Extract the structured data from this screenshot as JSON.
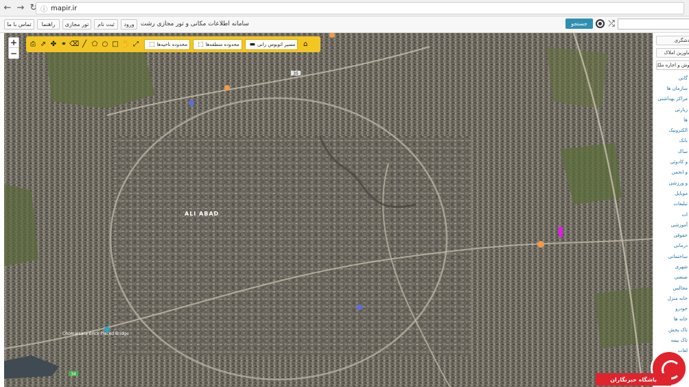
{
  "browser": {
    "url": "mapir.ir",
    "back_icon": "←",
    "forward_icon": "→",
    "reload_icon": "↻"
  },
  "header": {
    "title": "سامانه اطلاعات مکانی و تور مجازی رشت",
    "buttons": [
      "تماس با ما",
      "راهنما",
      "تور مجازی",
      "ثبت نام",
      "ورود"
    ],
    "search_button": "جستجو",
    "search_placeholder": ""
  },
  "toolbar": {
    "bus_route": "مسیر اتوبوس رانی",
    "zone_area": "محدوده منطقه‌ها",
    "district_area": "محدوده ناحیه‌ها"
  },
  "zoom": {
    "in": "+",
    "out": "−"
  },
  "map_labels": {
    "ali_abad": "ALI ABAD",
    "chomarsara": "Chomarsara Brick Placed Bridge",
    "road_35": "35",
    "road_34": "34"
  },
  "sidebar": {
    "buttons": [
      "گردشگری",
      "مشاورین املاک",
      "فروش و اجاره ملک"
    ],
    "items": [
      "گانی",
      "سازمان ها",
      "مراکز بهداشتی",
      "زیارتی",
      "ها",
      "الکترونیک",
      "بانک",
      "ساک",
      "و کادوئی",
      "و انجمن",
      "و ورزشی",
      "موبایل",
      "تبلیغات",
      "ات",
      "آموزشی",
      "حقوقی",
      "درمانی",
      "ساختمانی",
      "شهری",
      "صنعتی",
      "مجالس",
      "خانه منزل",
      "خودرو",
      "خانه ها",
      "تاک پخش",
      "تاک بیمه",
      "لغات"
    ]
  },
  "watermark": {
    "text": "باشگاه خبرنگاران"
  }
}
